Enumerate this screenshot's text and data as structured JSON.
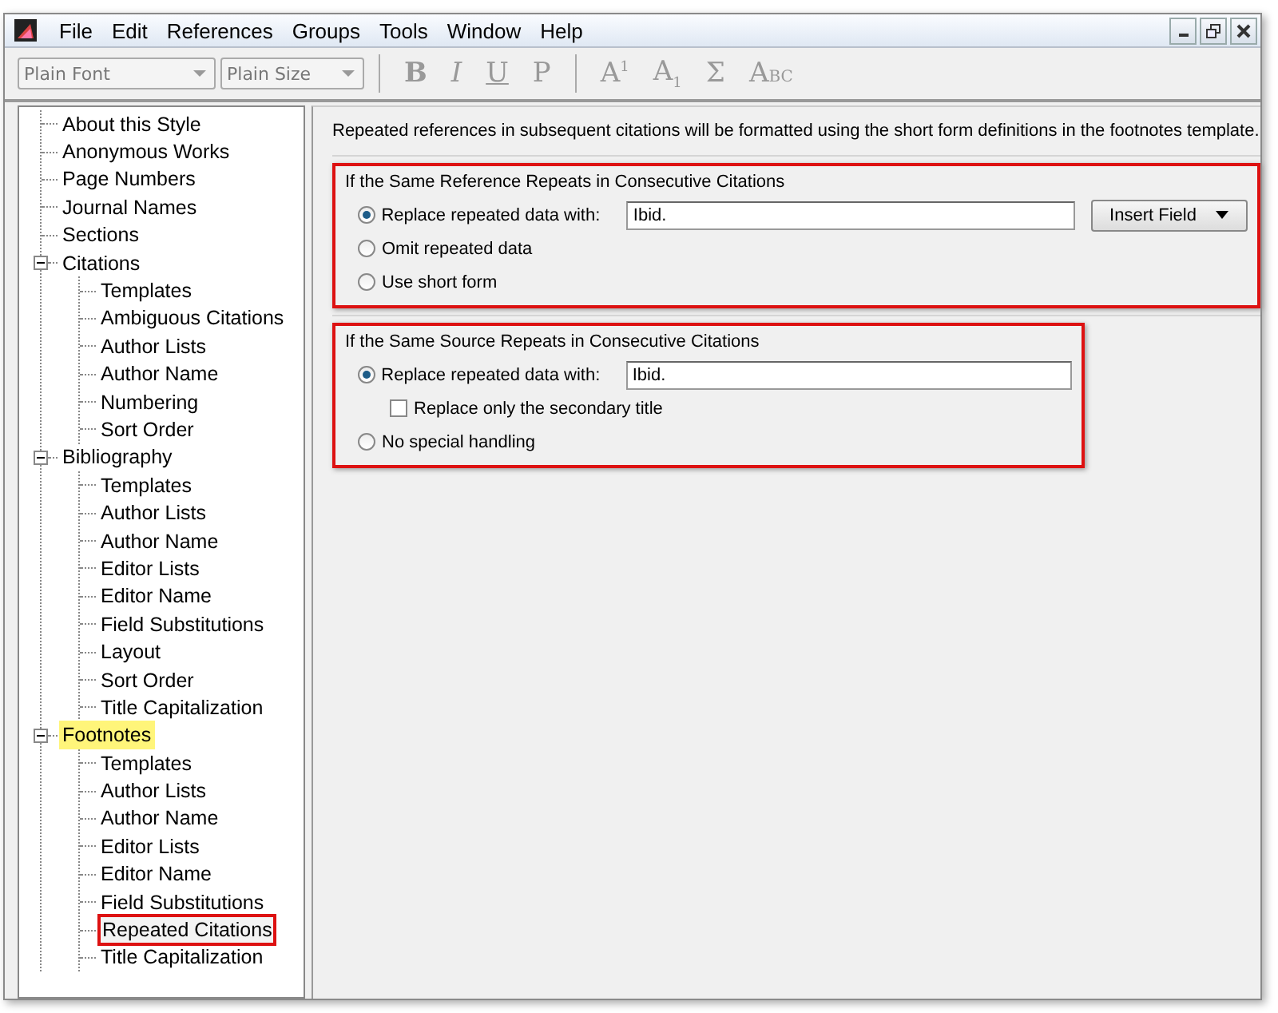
{
  "menu": [
    "File",
    "Edit",
    "References",
    "Groups",
    "Tools",
    "Window",
    "Help"
  ],
  "toolbar": {
    "font_field": {
      "value": "Plain Font"
    },
    "size_field": {
      "value": "Plain Size"
    },
    "format_buttons": [
      {
        "label": "B",
        "kind": "bold"
      },
      {
        "label": "I",
        "kind": "italic"
      },
      {
        "label": "U",
        "kind": "underline"
      },
      {
        "label": "P",
        "kind": "plain"
      }
    ],
    "script_buttons": [
      {
        "label": "A$^{1}$",
        "kind": "text"
      },
      {
        "label": "A$_{1}$",
        "kind": "text"
      },
      {
        "label": "Σ",
        "kind": "text"
      },
      {
        "label": "A",
        "kind": "smallcaps",
        "rest": "BC"
      }
    ]
  },
  "tree": [
    {
      "label": "About this Style",
      "selected": false,
      "highlighted": false
    },
    {
      "label": "Anonymous Works",
      "selected": false,
      "highlighted": false
    },
    {
      "label": "Page Numbers",
      "selected": false,
      "highlighted": false
    },
    {
      "label": "Journal Names",
      "selected": false,
      "highlighted": false
    },
    {
      "label": "Sections",
      "selected": false,
      "highlighted": false
    },
    {
      "label": "Citations",
      "selected": false,
      "highlighted": false,
      "expanded": true,
      "children": [
        {
          "label": "Templates",
          "selected": false
        },
        {
          "label": "Ambiguous Citations",
          "selected": false
        },
        {
          "label": "Author Lists",
          "selected": false
        },
        {
          "label": "Author Name",
          "selected": false
        },
        {
          "label": "Numbering",
          "selected": false
        },
        {
          "label": "Sort Order",
          "selected": false
        }
      ]
    },
    {
      "label": "Bibliography",
      "selected": false,
      "highlighted": false,
      "expanded": true,
      "children": [
        {
          "label": "Templates",
          "selected": false
        },
        {
          "label": "Author Lists",
          "selected": false
        },
        {
          "label": "Author Name",
          "selected": false
        },
        {
          "label": "Editor Lists",
          "selected": false
        },
        {
          "label": "Editor Name",
          "selected": false
        },
        {
          "label": "Field Substitutions",
          "selected": false
        },
        {
          "label": "Layout",
          "selected": false
        },
        {
          "label": "Sort Order",
          "selected": false
        },
        {
          "label": "Title Capitalization",
          "selected": false
        }
      ]
    },
    {
      "label": "Footnotes",
      "selected": false,
      "highlighted": true,
      "expanded": true,
      "children": [
        {
          "label": "Templates",
          "selected": false
        },
        {
          "label": "Author Lists",
          "selected": false
        },
        {
          "label": "Author Name",
          "selected": false
        },
        {
          "label": "Editor Lists",
          "selected": false
        },
        {
          "label": "Editor Name",
          "selected": false
        },
        {
          "label": "Field Substitutions",
          "selected": false
        },
        {
          "label": "Repeated Citations",
          "selected": true
        },
        {
          "label": "Title Capitalization",
          "selected": false
        }
      ]
    }
  ],
  "intro": "Repeated references in subsequent citations will be formatted using the short form definitions in the footnotes template.",
  "groups": [
    {
      "title": "If the Same Reference Repeats in Consecutive Citations",
      "highlighted": true,
      "options": [
        {
          "kind": "radio",
          "label": "Replace repeated data with:",
          "selected": true,
          "value": "Ibid.",
          "button": "Insert Field"
        },
        {
          "kind": "radio",
          "label": "Omit repeated data",
          "selected": false
        },
        {
          "kind": "radio",
          "label": "Use short form",
          "selected": false
        }
      ]
    },
    {
      "title": "If the Same Source Repeats in Consecutive Citations",
      "highlighted": true,
      "options": [
        {
          "kind": "radio",
          "label": "Replace repeated data with:",
          "selected": true,
          "value": "Ibid."
        },
        {
          "kind": "checkbox",
          "label": "Replace only the secondary title",
          "checked": false
        },
        {
          "kind": "radio",
          "label": "No special handling",
          "selected": false
        }
      ]
    }
  ]
}
